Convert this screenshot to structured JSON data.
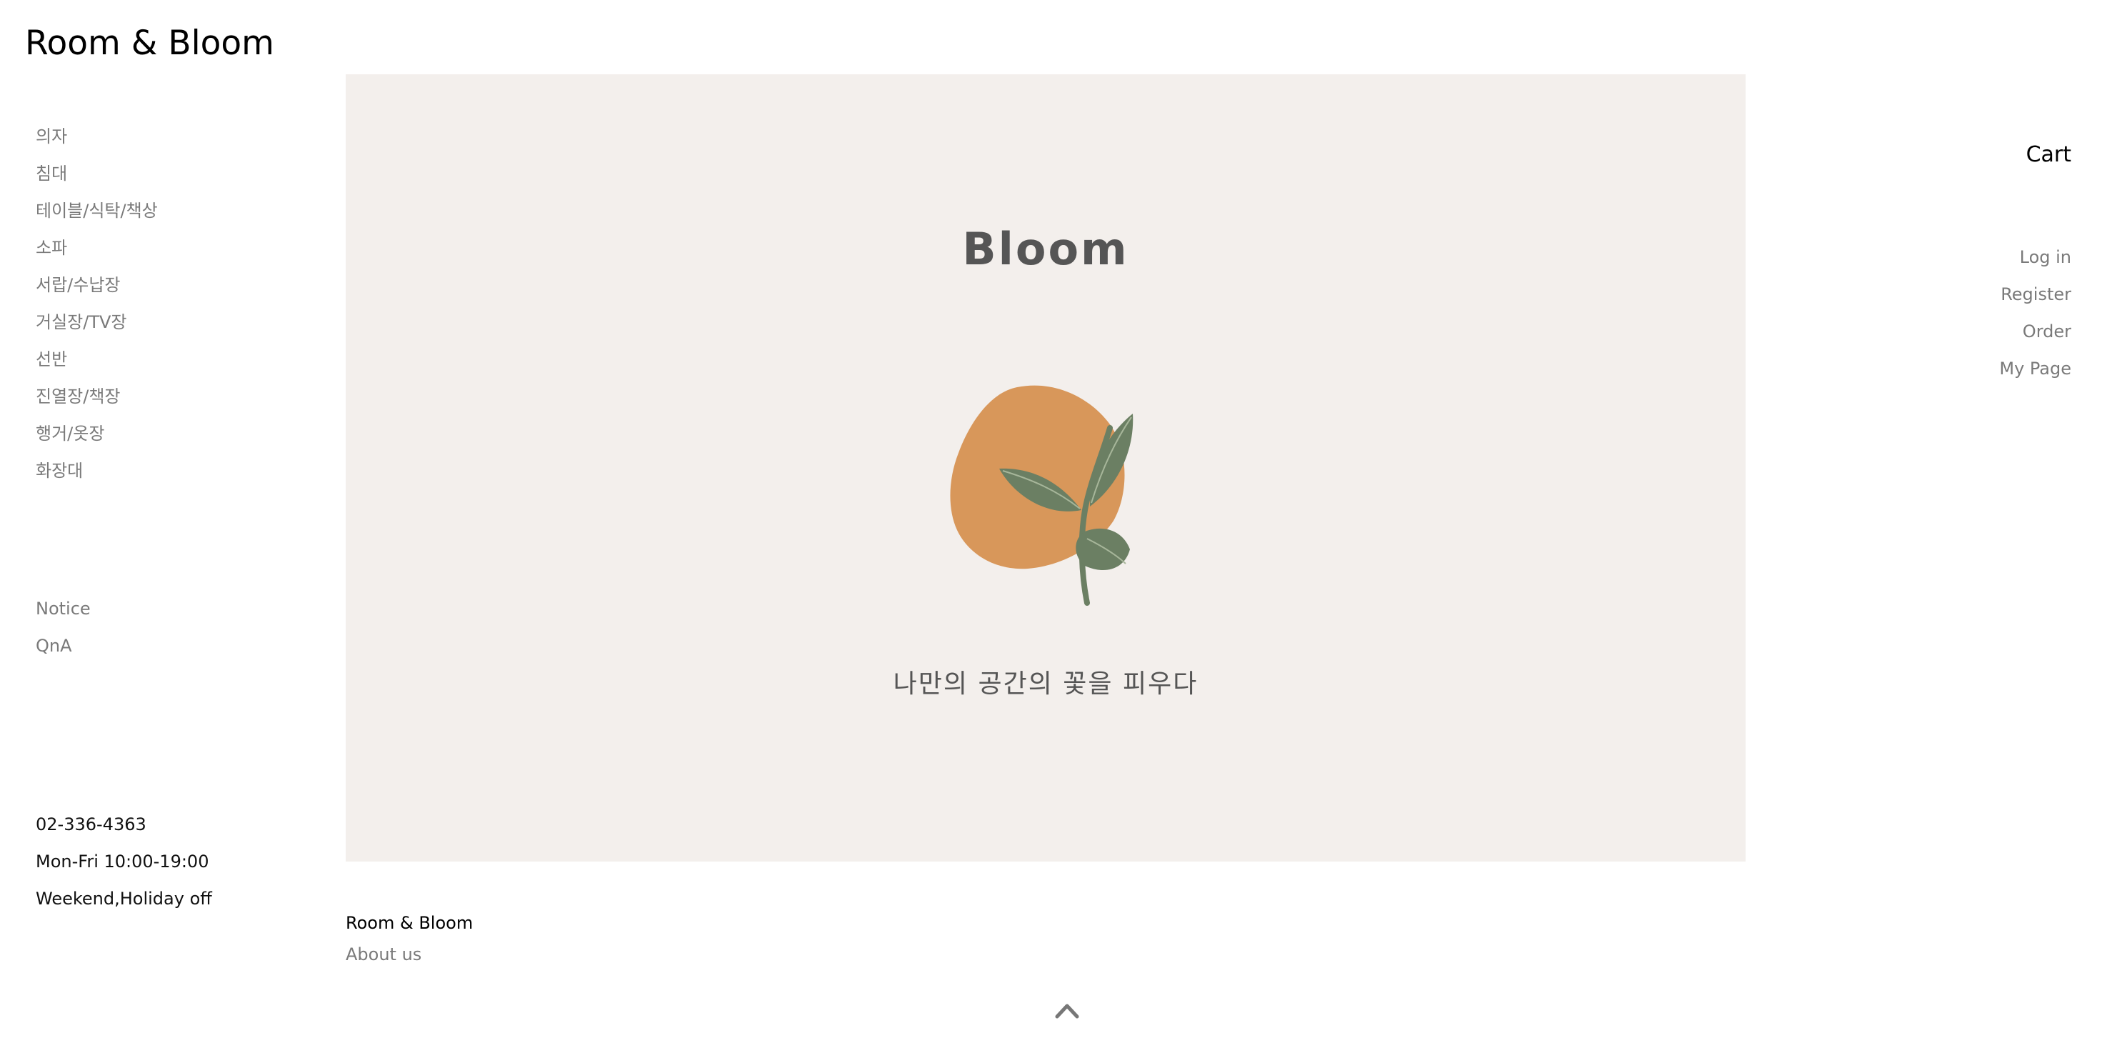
{
  "site": {
    "title": "Room & Bloom"
  },
  "categories": [
    {
      "label": "의자"
    },
    {
      "label": "침대"
    },
    {
      "label": "테이블/식탁/책상"
    },
    {
      "label": "소파"
    },
    {
      "label": "서랍/수납장"
    },
    {
      "label": "거실장/TV장"
    },
    {
      "label": "선반"
    },
    {
      "label": "진열장/책장"
    },
    {
      "label": "행거/옷장"
    },
    {
      "label": "화장대"
    }
  ],
  "boards": [
    {
      "label": "Notice"
    },
    {
      "label": "QnA"
    }
  ],
  "contact": {
    "phone": "02-336-4363",
    "hours": "Mon-Fri 10:00-19:00",
    "off": "Weekend,Holiday off"
  },
  "hero": {
    "title": "Bloom",
    "tagline": "나만의 공간의 꽃을 피우다",
    "colors": {
      "background": "#f3efec",
      "blob": "#d8975a",
      "leaf": "#6b7f63"
    }
  },
  "right_nav": {
    "cart": "Cart",
    "account": [
      {
        "label": "Log in"
      },
      {
        "label": "Register"
      },
      {
        "label": "Order"
      },
      {
        "label": "My Page"
      }
    ]
  },
  "footer": {
    "brand": "Room & Bloom",
    "about": "About us"
  },
  "icons": {
    "to_top": "caret-up-icon"
  }
}
